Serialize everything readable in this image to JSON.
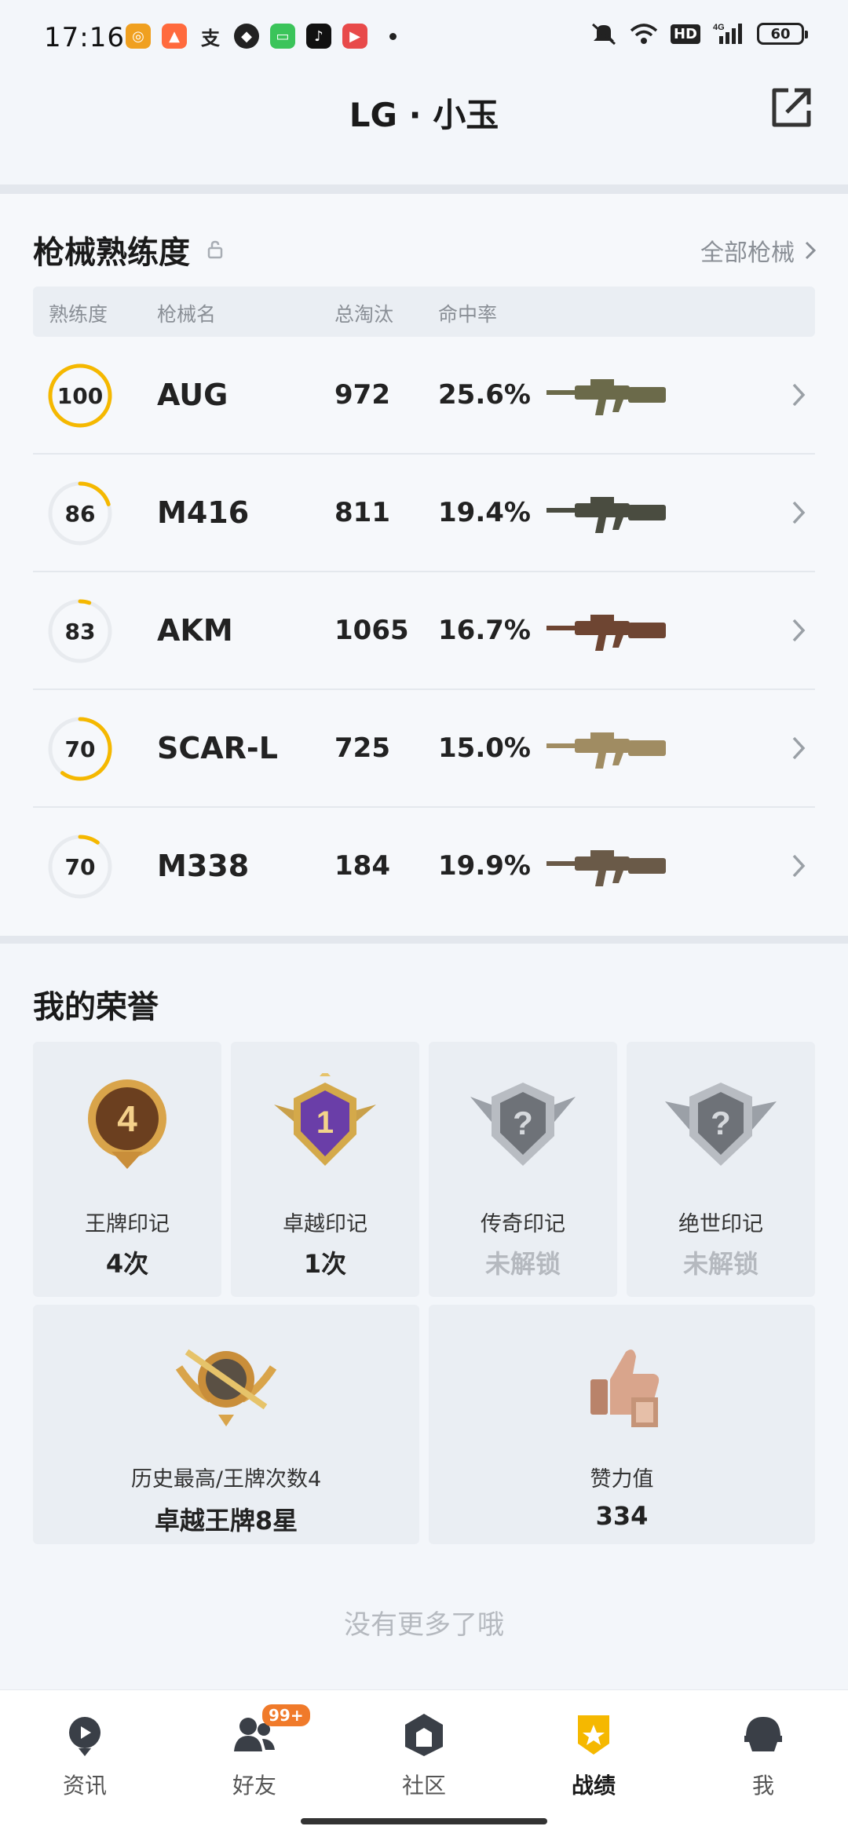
{
  "status_bar": {
    "time": "17:16",
    "hd": "HD",
    "network": "4G",
    "battery": "60"
  },
  "header": {
    "title": "LG · 小玉"
  },
  "weapons": {
    "title": "枪械熟练度",
    "all_link": "全部枪械",
    "columns": [
      "熟练度",
      "枪械名",
      "总淘汰",
      "命中率"
    ],
    "rows": [
      {
        "mastery": "100",
        "mastery_fraction": 1.0,
        "name": "AUG",
        "kills": "972",
        "rate": "25.6%",
        "color": "#6b6a4a"
      },
      {
        "mastery": "86",
        "mastery_fraction": 0.2,
        "name": "M416",
        "kills": "811",
        "rate": "19.4%",
        "color": "#4a4c40"
      },
      {
        "mastery": "83",
        "mastery_fraction": 0.05,
        "name": "AKM",
        "kills": "1065",
        "rate": "16.7%",
        "color": "#6e4532"
      },
      {
        "mastery": "70",
        "mastery_fraction": 0.6,
        "name": "SCAR-L",
        "kills": "725",
        "rate": "15.0%",
        "color": "#a08c62"
      },
      {
        "mastery": "70",
        "mastery_fraction": 0.1,
        "name": "M338",
        "kills": "184",
        "rate": "19.9%",
        "color": "#6a5a48"
      }
    ]
  },
  "honors": {
    "title": "我的荣誉",
    "medals": [
      {
        "label": "王牌印记",
        "count": "4次",
        "locked": false,
        "badge": "4"
      },
      {
        "label": "卓越印记",
        "count": "1次",
        "locked": false,
        "badge": "1"
      },
      {
        "label": "传奇印记",
        "count": "未解锁",
        "locked": true,
        "badge": "?"
      },
      {
        "label": "绝世印记",
        "count": "未解锁",
        "locked": true,
        "badge": "?"
      }
    ],
    "history": {
      "label": "历史最高/王牌次数4",
      "value": "卓越王牌8星"
    },
    "likes": {
      "label": "赞力值",
      "value": "334"
    },
    "no_more": "没有更多了哦"
  },
  "nav": {
    "items": [
      {
        "label": "资讯",
        "icon": "news-icon",
        "active": false
      },
      {
        "label": "好友",
        "icon": "friends-icon",
        "active": false,
        "badge": "99+"
      },
      {
        "label": "社区",
        "icon": "community-icon",
        "active": false
      },
      {
        "label": "战绩",
        "icon": "record-icon",
        "active": true
      },
      {
        "label": "我",
        "icon": "profile-icon",
        "active": false
      }
    ]
  },
  "colors": {
    "accent": "#f5b800",
    "ring_track": "#e8ebef",
    "locked_text": "#b5b9bf"
  }
}
